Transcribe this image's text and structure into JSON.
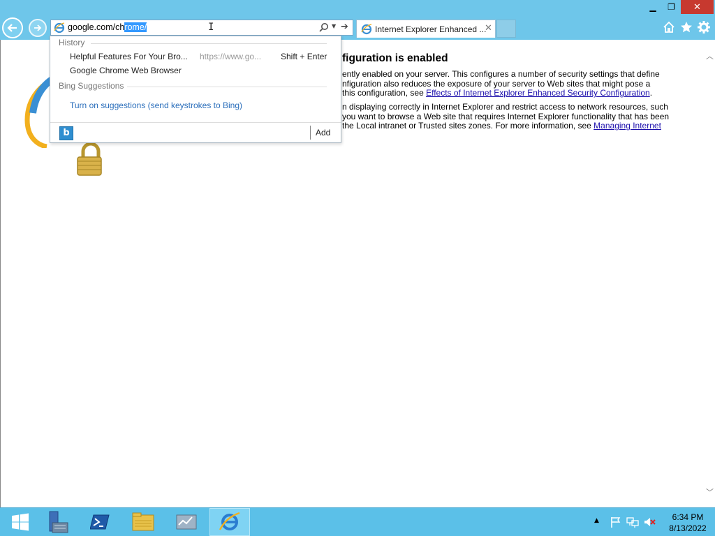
{
  "window": {
    "minimize_glyph": "▁",
    "maximize_glyph": "❐",
    "close_glyph": "✕"
  },
  "addressbar": {
    "value_unselected": "google.com/ch",
    "value_selected": "rome/"
  },
  "tab": {
    "title": "Internet Explorer Enhanced ...",
    "close_glyph": "✕"
  },
  "page": {
    "heading": "figuration is enabled",
    "para1": [
      "ently enabled on your server. This configures a number of security settings that define",
      "nfiguration also reduces the exposure of your server to Web sites that might pose a"
    ],
    "para1_line3_prefix": " this configuration, see ",
    "para1_link": "Effects of Internet Explorer Enhanced Security Configuration",
    "para1_line3_suffix": ".",
    "para2": [
      "n displaying correctly in Internet Explorer and restrict access to network resources, such",
      "you want to browse a Web site that requires Internet Explorer functionality that has been"
    ],
    "para2_line3_prefix": " the Local intranet or Trusted sites zones. For more information, see ",
    "para2_link": "Managing Internet"
  },
  "dropdown": {
    "history_label": "History",
    "history_items": [
      {
        "title": "Helpful Features For Your Bro...",
        "url": "https://www.go...",
        "hint": "Shift + Enter"
      },
      {
        "title": "Google Chrome Web Browser"
      }
    ],
    "bing_label": "Bing Suggestions",
    "suggest_link": "Turn on suggestions (send keystrokes to Bing)",
    "add_label": "Add",
    "bing_glyph": "b"
  },
  "taskbar": {
    "time": "6:34 PM",
    "date": "8/13/2022"
  },
  "colors": {
    "chrome_blue": "#6ec6ea",
    "taskbar_blue": "#5bc0e8",
    "link_blue": "#1a0dab",
    "close_red": "#c7392f"
  }
}
